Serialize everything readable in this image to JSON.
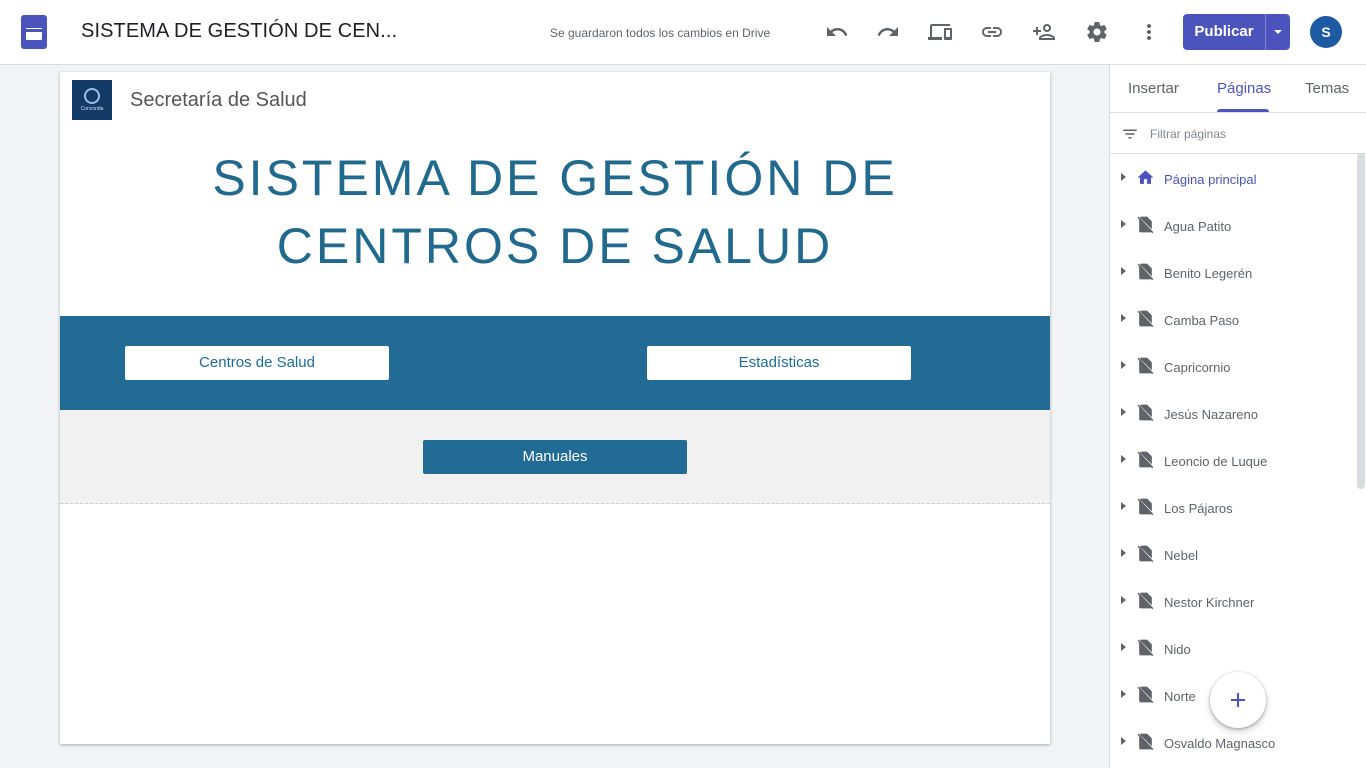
{
  "header": {
    "doc_title": "SISTEMA DE GESTIÓN DE CEN...",
    "save_status": "Se guardaron todos los cambios en Drive",
    "publish_label": "Publicar",
    "avatar_initial": "S",
    "icons": [
      "undo-icon",
      "redo-icon",
      "preview-devices-icon",
      "link-icon",
      "share-add-person-icon",
      "settings-icon",
      "more-vert-icon"
    ]
  },
  "site": {
    "name": "Secretaría de Salud",
    "logo_text": "Concordia",
    "title_line1": "SISTEMA DE GESTIÓN DE",
    "title_line2": "CENTROS DE SALUD",
    "buttons": {
      "centros": "Centros de Salud",
      "estadisticas": "Estadísticas",
      "manuales": "Manuales"
    },
    "colors": {
      "primary": "#216b94",
      "title": "#22698e"
    }
  },
  "panel": {
    "tabs": [
      "Insertar",
      "Páginas",
      "Temas"
    ],
    "active_tab": "Páginas",
    "filter_placeholder": "Filtrar páginas",
    "pages": [
      "Página principal",
      "Agua Patito",
      "Benito Legerén",
      "Camba Paso",
      "Capricornio",
      "Jesús Nazareno",
      "Leoncio de Luque",
      "Los Pájaros",
      "Nebel",
      "Nestor Kirchner",
      "Nido",
      "Norte",
      "Osvaldo Magnasco"
    ],
    "active_page": "Página principal"
  },
  "colors": {
    "accent": "#4b53bc",
    "text_secondary": "#5f6368"
  }
}
